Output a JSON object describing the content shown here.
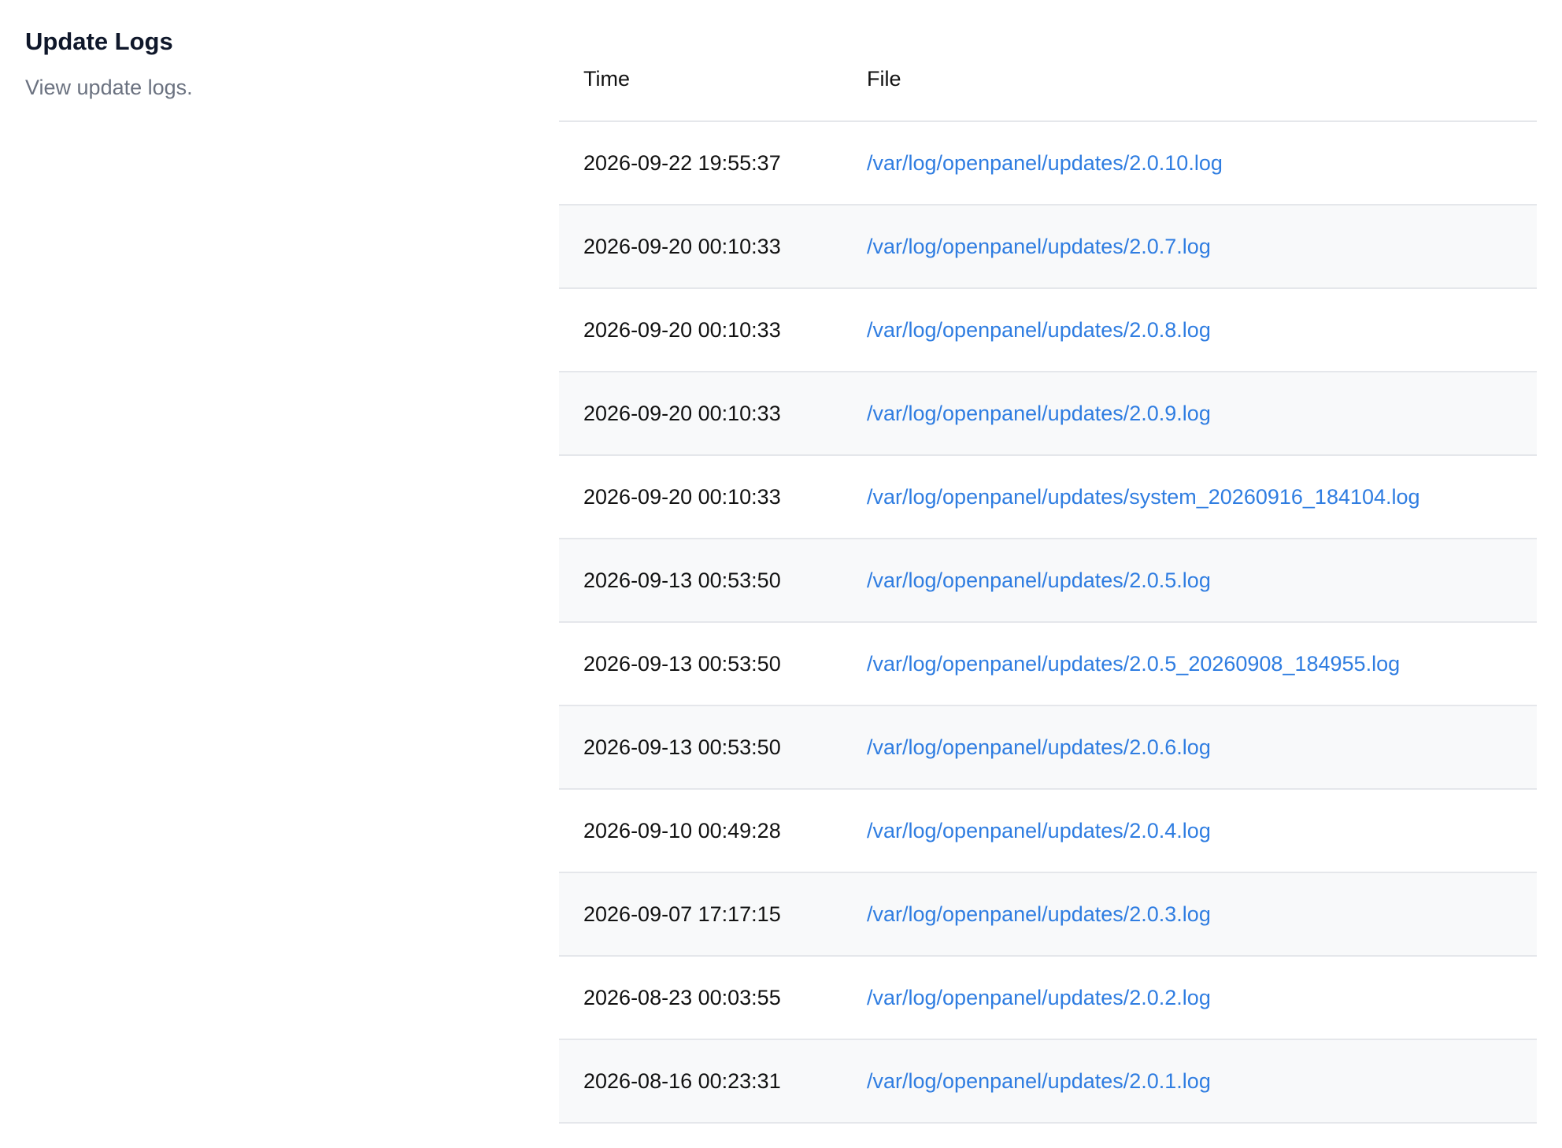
{
  "section": {
    "title": "Update Logs",
    "description": "View update logs."
  },
  "table": {
    "columns": {
      "time": "Time",
      "file": "File"
    },
    "rows": [
      {
        "time": "2026-09-22 19:55:37",
        "file": "/var/log/openpanel/updates/2.0.10.log"
      },
      {
        "time": "2026-09-20 00:10:33",
        "file": "/var/log/openpanel/updates/2.0.7.log"
      },
      {
        "time": "2026-09-20 00:10:33",
        "file": "/var/log/openpanel/updates/2.0.8.log"
      },
      {
        "time": "2026-09-20 00:10:33",
        "file": "/var/log/openpanel/updates/2.0.9.log"
      },
      {
        "time": "2026-09-20 00:10:33",
        "file": "/var/log/openpanel/updates/system_20260916_184104.log"
      },
      {
        "time": "2026-09-13 00:53:50",
        "file": "/var/log/openpanel/updates/2.0.5.log"
      },
      {
        "time": "2026-09-13 00:53:50",
        "file": "/var/log/openpanel/updates/2.0.5_20260908_184955.log"
      },
      {
        "time": "2026-09-13 00:53:50",
        "file": "/var/log/openpanel/updates/2.0.6.log"
      },
      {
        "time": "2026-09-10 00:49:28",
        "file": "/var/log/openpanel/updates/2.0.4.log"
      },
      {
        "time": "2026-09-07 17:17:15",
        "file": "/var/log/openpanel/updates/2.0.3.log"
      },
      {
        "time": "2026-08-23 00:03:55",
        "file": "/var/log/openpanel/updates/2.0.2.log"
      },
      {
        "time": "2026-08-16 00:23:31",
        "file": "/var/log/openpanel/updates/2.0.1.log"
      }
    ]
  },
  "colors": {
    "link": "#2f7de1",
    "stripe": "#f8f9fa",
    "border": "#e5e7eb",
    "muted_text": "#6b7280",
    "title_text": "#0f172a"
  }
}
